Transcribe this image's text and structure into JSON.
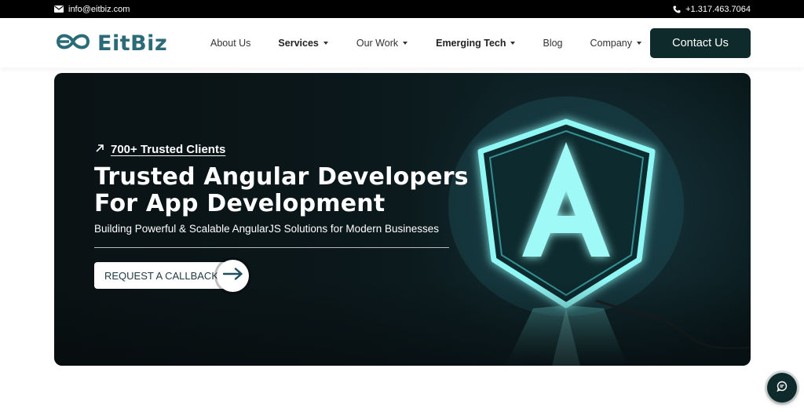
{
  "topbar": {
    "email": "info@eitbiz.com",
    "email_icon": "envelope-icon",
    "phone": "+1.317.463.7064",
    "phone_icon": "phone-icon"
  },
  "header": {
    "logo_text": "EitBiz",
    "logo_icon": "infinity-e-logo",
    "nav": [
      {
        "label": "About Us",
        "bold": false,
        "dropdown": false
      },
      {
        "label": "Services",
        "bold": true,
        "dropdown": true
      },
      {
        "label": "Our Work",
        "bold": false,
        "dropdown": true
      },
      {
        "label": "Emerging Tech",
        "bold": true,
        "dropdown": true
      },
      {
        "label": "Blog",
        "bold": false,
        "dropdown": false
      },
      {
        "label": "Company",
        "bold": false,
        "dropdown": true
      }
    ],
    "contact_label": "Contact Us"
  },
  "hero": {
    "clients_link": "700+ Trusted Clients",
    "title_line1": "Trusted Angular Developers",
    "title_line2": "For App Development",
    "subtitle": "Building Powerful & Scalable AngularJS Solutions for Modern Businesses",
    "cta_label": "REQUEST A CALLBACK",
    "cta_icon": "arrow-right-icon",
    "art": "angular-neon-logo",
    "glow_color": "#7ef2f0"
  },
  "chat": {
    "icon": "chat-icon"
  },
  "colors": {
    "brand": "#2b6b78",
    "dark": "#0f2a2a",
    "topbar": "#000000"
  }
}
